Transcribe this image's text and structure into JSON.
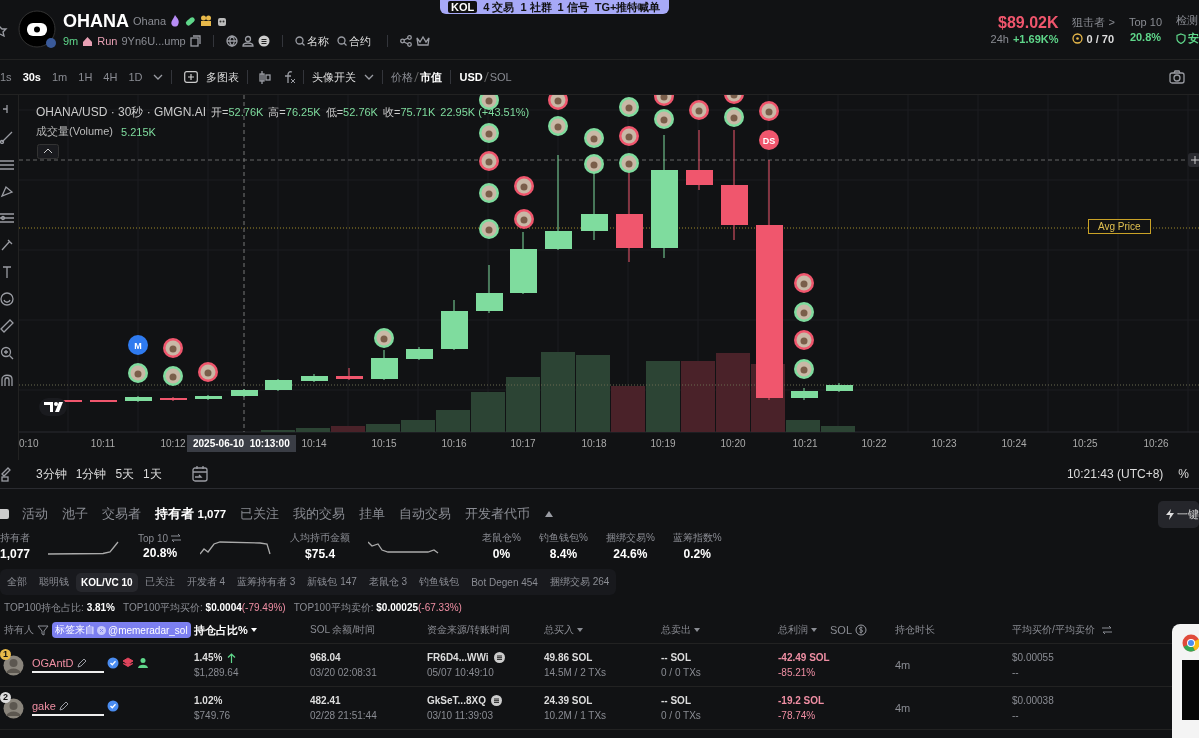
{
  "banner": {
    "items": [
      "KOL",
      "4 交易",
      "1 社群",
      "1 信号",
      "TG+推特喊单"
    ]
  },
  "token": {
    "symbol": "OHANA",
    "name": "Ohana",
    "age": "9m",
    "platform": "Run",
    "address": "9Yn6U...ump",
    "searches": [
      "名称",
      "合约"
    ]
  },
  "market": {
    "price": "$89.02K",
    "period": "24h",
    "change": "+1.69K%",
    "snipers_label": "狙击者 >",
    "snipers_value": "0 / 70",
    "top10_label": "Top 10",
    "top10_value": "20.8%",
    "check_label": "检测",
    "check_value": "安"
  },
  "chart_toolbar": {
    "intervals": [
      {
        "label": "1s",
        "selected": false
      },
      {
        "label": "30s",
        "selected": true
      },
      {
        "label": "1m",
        "selected": false
      },
      {
        "label": "1H",
        "selected": false
      },
      {
        "label": "4H",
        "selected": false
      },
      {
        "label": "1D",
        "selected": false
      }
    ],
    "multi_chart": "多图表",
    "avatar_toggle": "头像开关",
    "price_modes": [
      {
        "label": "价格",
        "selected": false
      },
      {
        "label": "市值",
        "selected": true
      }
    ],
    "currencies": [
      {
        "label": "USD",
        "selected": true
      },
      {
        "label": "SOL",
        "selected": false
      }
    ]
  },
  "chart": {
    "pair": "OHANA/USD · 30秒 · GMGN.AI",
    "ohlc": [
      {
        "label": "开=",
        "value": "52.76K"
      },
      {
        "label": "高=",
        "value": "76.25K"
      },
      {
        "label": "低=",
        "value": "52.76K"
      },
      {
        "label": "收=",
        "value": "75.71K"
      }
    ],
    "change": "22.95K (+43.51%)",
    "volume_label": "成交量(Volume)",
    "volume_value": "5.215K",
    "avg_price_label": "Avg Price",
    "badges": [
      {
        "text": "M",
        "color": "#2f7bf0"
      },
      {
        "text": "DS",
        "color": "#f0566d"
      }
    ],
    "crosshair_time": "2025-06-10  10:13:00",
    "time_axis": [
      "0:10",
      "10:11",
      "10:12",
      "10:14",
      "10:15",
      "10:16",
      "10:17",
      "10:18",
      "10:19",
      "10:20",
      "10:21",
      "10:22",
      "10:23",
      "10:24",
      "10:25",
      "10:26"
    ]
  },
  "range_bar": {
    "ranges": [
      "3分钟",
      "1分钟",
      "5天",
      "1天"
    ],
    "clock": "10:21:43 (UTC+8)",
    "percent": "%"
  },
  "tabs": [
    {
      "label": "活动",
      "selected": false
    },
    {
      "label": "池子",
      "selected": false
    },
    {
      "label": "交易者",
      "selected": false
    },
    {
      "label": "持有者",
      "count": "1,077",
      "selected": true
    },
    {
      "label": "已关注",
      "selected": false
    },
    {
      "label": "我的交易",
      "selected": false
    },
    {
      "label": "挂单",
      "selected": false
    },
    {
      "label": "自动交易",
      "selected": false
    },
    {
      "label": "开发者代币",
      "selected": false
    }
  ],
  "quick_buy": "一键",
  "stats": [
    {
      "label": "持有者",
      "value": "1,077",
      "kind": "sparkline"
    },
    {
      "label": "Top 10",
      "value": "20.8%",
      "kind": "sparkline",
      "swap": true
    },
    {
      "label": "人均持币金额",
      "value": "$75.4",
      "kind": "sparkline"
    },
    {
      "label": "老鼠仓%",
      "value": "0%",
      "kind": "plain"
    },
    {
      "label": "钓鱼钱包%",
      "value": "8.4%",
      "kind": "plain"
    },
    {
      "label": "捆绑交易%",
      "value": "24.6%",
      "kind": "plain"
    },
    {
      "label": "蓝筹指数%",
      "value": "0.2%",
      "kind": "plain"
    }
  ],
  "filters": [
    {
      "label": "全部",
      "selected": false
    },
    {
      "label": "聪明钱",
      "selected": false
    },
    {
      "label": "KOL/VC 10",
      "selected": true
    },
    {
      "label": "已关注",
      "selected": false
    },
    {
      "label": "开发者 4",
      "selected": false
    },
    {
      "label": "蓝筹持有者 3",
      "selected": false
    },
    {
      "label": "新钱包 147",
      "selected": false
    },
    {
      "label": "老鼠仓 3",
      "selected": false
    },
    {
      "label": "钓鱼钱包",
      "selected": false
    },
    {
      "label": "Bot Degen 454",
      "selected": false
    },
    {
      "label": "捆绑交易 264",
      "selected": false
    }
  ],
  "summary": [
    {
      "label": "TOP100持仓占比:",
      "value": "3.81%"
    },
    {
      "label": "TOP100平均买价:",
      "value": "$0.0004",
      "change": "(-79.49%)"
    },
    {
      "label": "TOP100平均卖价:",
      "value": "$0.00025",
      "change": "(-67.33%)"
    }
  ],
  "table": {
    "tag": {
      "label": "标签来自",
      "handle": "@memeradar_sol"
    },
    "columns": [
      {
        "label": "持有人",
        "active": false
      },
      {
        "label": "持仓占比%",
        "sortable": true,
        "active": true
      },
      {
        "label": "SOL 余额/时间",
        "active": false
      },
      {
        "label": "资金来源/转账时间",
        "active": false
      },
      {
        "label": "总买入",
        "sortable": true,
        "active": false
      },
      {
        "label": "总卖出",
        "sortable": true,
        "active": false
      },
      {
        "label": "总利润",
        "sortable": true,
        "active": false,
        "unit": "SOL"
      },
      {
        "label": "持仓时长",
        "active": false
      },
      {
        "label": "平均买价/平均卖价",
        "active": false,
        "swap": true
      }
    ],
    "rows": [
      {
        "rank": "1",
        "name": "OGAntD",
        "badges": [
          {
            "kind": "verified"
          },
          {
            "kind": "layers"
          },
          {
            "kind": "user"
          }
        ],
        "share": "1.45%",
        "trend_up": true,
        "share_value": "$1,289.64",
        "sol_balance": "968.04",
        "sol_time": "03/20 02:08:31",
        "source": "FR6D4...WWi",
        "source_time": "05/07 10:49:10",
        "bought": "49.86 SOL",
        "bought_detail": "14.5M / 2 TXs",
        "sold": "-- SOL",
        "sold_detail": "0 / 0 TXs",
        "profit": "-42.49 SOL",
        "profit_pct": "-85.21%",
        "loss": true,
        "hold_time": "4m",
        "avg_buy": "$0.00055",
        "avg_sell": "--"
      },
      {
        "rank": "2",
        "name": "gake",
        "badges": [
          {
            "kind": "verified"
          }
        ],
        "share": "1.02%",
        "trend_up": false,
        "share_value": "$749.76",
        "sol_balance": "482.41",
        "sol_time": "02/28 21:51:44",
        "source": "GkSeT...8XQ",
        "source_time": "03/10 11:39:03",
        "bought": "24.39 SOL",
        "bought_detail": "10.2M / 1 TXs",
        "sold": "-- SOL",
        "sold_detail": "0 / 0 TXs",
        "profit": "-19.2 SOL",
        "profit_pct": "-78.74%",
        "loss": true,
        "hold_time": "4m",
        "avg_buy": "$0.00038",
        "avg_sell": "--"
      }
    ]
  }
}
